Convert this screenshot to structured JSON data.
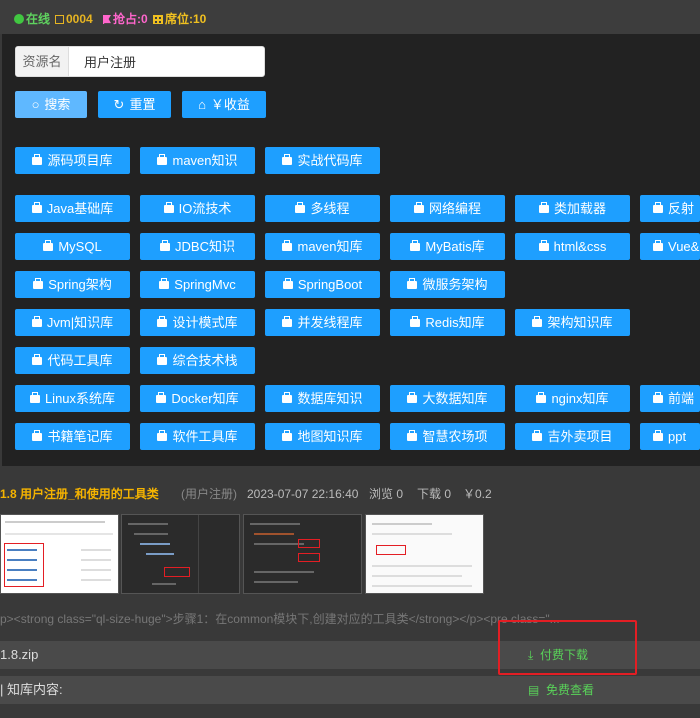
{
  "status": {
    "online": "在线",
    "count": "0004",
    "grab": "抢占:0",
    "seats": "席位:10"
  },
  "search": {
    "addon_label": "资源名",
    "value": "用户注册"
  },
  "actions": {
    "search": "搜索",
    "reset": "重置",
    "income": "￥收益"
  },
  "categories": {
    "row1": [
      "源码项目库",
      "maven知识",
      "实战代码库"
    ],
    "row2": [
      "Java基础库",
      "IO流技术",
      "多线程",
      "网络编程",
      "类加载器",
      "反射"
    ],
    "row3": [
      "MySQL",
      "JDBC知识",
      "maven知库",
      "MyBatis库",
      "html&css",
      "Vue&"
    ],
    "row4": [
      "Spring架构",
      "SpringMvc",
      "SpringBoot",
      "微服务架构"
    ],
    "row5": [
      "Jvm|知识库",
      "设计模式库",
      "并发线程库",
      "Redis知库",
      "架构知识库"
    ],
    "row6": [
      "代码工具库",
      "综合技术栈"
    ],
    "row7": [
      "Linux系统库",
      "Docker知库",
      "数据库知识",
      "大数据知库",
      "nginx知库",
      "前端"
    ],
    "row8": [
      "书籍笔记库",
      "软件工具库",
      "地图知识库",
      "智慧农场项",
      "吉外卖项目",
      "ppt"
    ]
  },
  "result": {
    "title": "1.8 用户注册_和使用的工具类",
    "category": "(用户注册)",
    "date": "2023-07-07 22:16:40",
    "views": "浏览 0",
    "downloads": "下载 0",
    "price": "￥0.2",
    "snippet": "p><strong class=\"ql-size-huge\">步骤1：在common模块下,创建对应的工具类</strong></p><pre class=\"...",
    "file_name": "1.8.zip",
    "paid_download": "付费下载",
    "kb_label": "| 知库内容:",
    "free_view": "免费查看"
  },
  "colors": {
    "accent": "#1e9fff",
    "online": "#5fd35f",
    "title": "#f5b300",
    "action": "#59d359",
    "highlight": "#e31e24"
  }
}
